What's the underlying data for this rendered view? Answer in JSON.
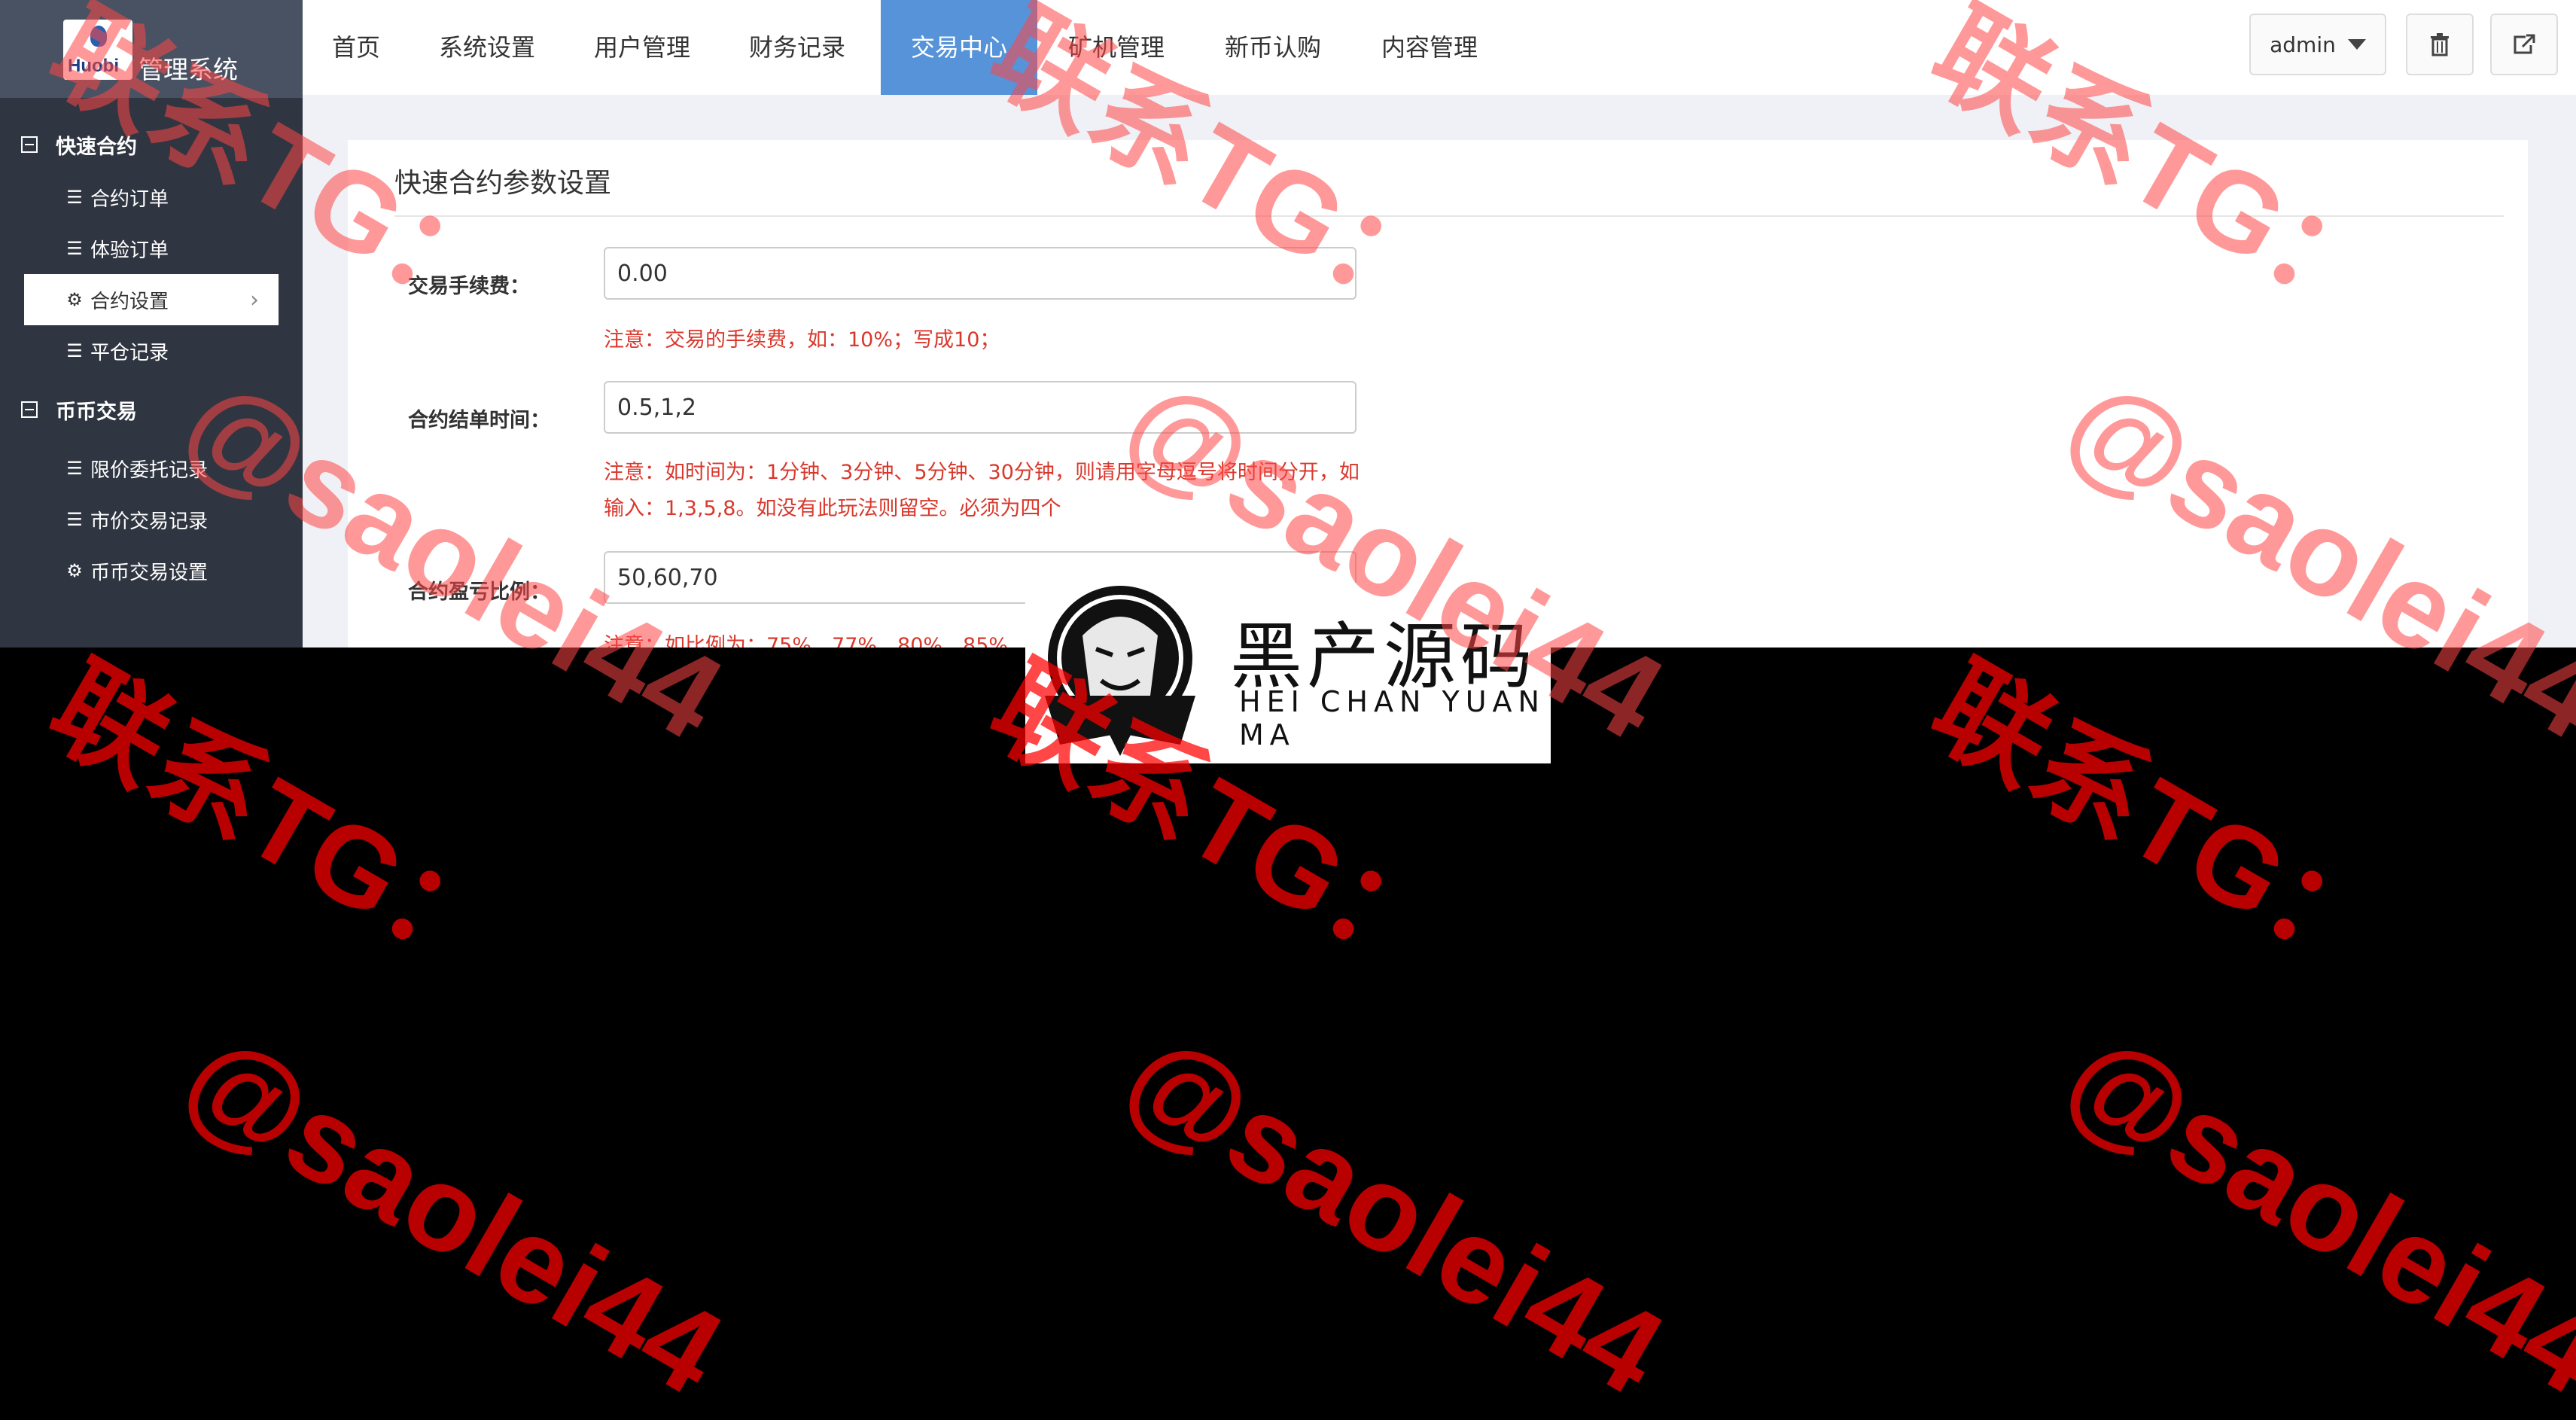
{
  "app": {
    "logo_text": "Huobi",
    "title": "管理系统"
  },
  "sidebar": {
    "groups": [
      {
        "label": "快速合约",
        "items": [
          {
            "label": "合约订单",
            "icon": "list-icon"
          },
          {
            "label": "体验订单",
            "icon": "list-icon"
          },
          {
            "label": "合约设置",
            "icon": "gear-icon",
            "active": true
          },
          {
            "label": "平仓记录",
            "icon": "list-icon"
          }
        ]
      },
      {
        "label": "币币交易",
        "items": [
          {
            "label": "限价委托记录",
            "icon": "list-icon"
          },
          {
            "label": "市价交易记录",
            "icon": "list-icon"
          },
          {
            "label": "币币交易设置",
            "icon": "gear-icon"
          }
        ]
      }
    ]
  },
  "topnav": {
    "tabs": [
      "首页",
      "系统设置",
      "用户管理",
      "财务记录",
      "交易中心",
      "矿机管理",
      "新币认购",
      "内容管理"
    ],
    "active_tab": "交易中心",
    "user": "admin"
  },
  "panel": {
    "title": "快速合约参数设置",
    "fields": [
      {
        "label": "交易手续费：",
        "value": "0.00",
        "note": "注意：交易的手续费，如：10%；写成10；"
      },
      {
        "label": "合约结单时间：",
        "value": "0.5,1,2",
        "note": "注意：如时间为：1分钟、3分钟、5分钟、30分钟，则请用字母逗号将时间分开，如输入：1,3,5,8。如没有此玩法则留空。必须为四个"
      },
      {
        "label": "合约盈亏比例：",
        "value": "50,60,70",
        "note": "注意：如比例为：75%、77%、80%、85%"
      }
    ]
  },
  "overlay_logo": {
    "name_cn": "黑产源码",
    "name_en": "HEI CHAN YUAN MA"
  },
  "watermark": {
    "line1": "联系TG：",
    "line2": "@saolei44"
  },
  "colors": {
    "sidebar_bg": "#303641",
    "logo_bar_bg": "#495263",
    "active_tab_bg": "#5793d9",
    "note_red": "#d9382c",
    "watermark_red": "#ff0000"
  }
}
